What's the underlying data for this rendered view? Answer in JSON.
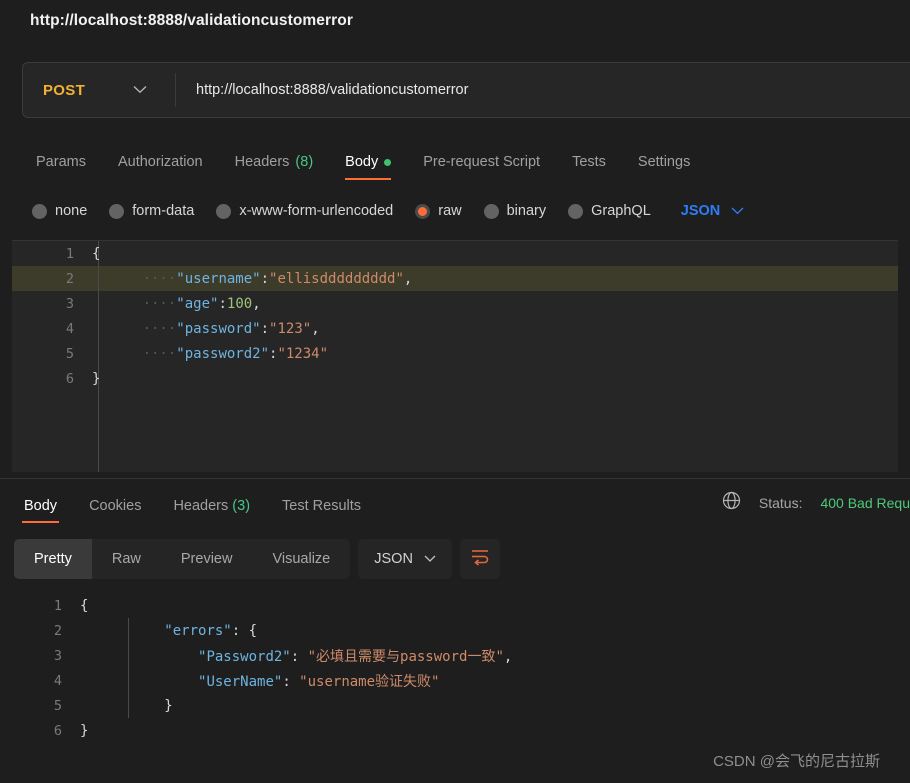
{
  "title": "http://localhost:8888/validationcustomerror",
  "request": {
    "method": "POST",
    "url": "http://localhost:8888/validationcustomerror",
    "tabs": [
      {
        "label": "Params",
        "active": false
      },
      {
        "label": "Authorization",
        "active": false
      },
      {
        "label": "Headers",
        "count": "(8)",
        "active": false
      },
      {
        "label": "Body",
        "active": true,
        "dot": true
      },
      {
        "label": "Pre-request Script",
        "active": false
      },
      {
        "label": "Tests",
        "active": false
      },
      {
        "label": "Settings",
        "active": false
      }
    ],
    "body_types": [
      {
        "label": "none",
        "selected": false
      },
      {
        "label": "form-data",
        "selected": false
      },
      {
        "label": "x-www-form-urlencoded",
        "selected": false
      },
      {
        "label": "raw",
        "selected": true
      },
      {
        "label": "binary",
        "selected": false
      },
      {
        "label": "GraphQL",
        "selected": false
      }
    ],
    "format": "JSON",
    "code": {
      "line_numbers": [
        "1",
        "2",
        "3",
        "4",
        "5",
        "6"
      ],
      "lines": [
        {
          "open": "{"
        },
        {
          "dots": "····",
          "key": "\"username\"",
          "colon": ":",
          "value": "\"ellisddddddddd\"",
          "tail": ","
        },
        {
          "dots": "····",
          "key": "\"age\"",
          "colon": ":",
          "num": "100",
          "tail": ","
        },
        {
          "dots": "····",
          "key": "\"password\"",
          "colon": ":",
          "value": "\"123\"",
          "tail": ","
        },
        {
          "dots": "····",
          "key": "\"password2\"",
          "colon": ":",
          "value": "\"1234\"",
          "tail": ""
        },
        {
          "close": "}"
        }
      ]
    }
  },
  "response": {
    "tabs": [
      {
        "label": "Body",
        "active": true
      },
      {
        "label": "Cookies",
        "active": false
      },
      {
        "label": "Headers",
        "count": "(3)",
        "active": false
      },
      {
        "label": "Test Results",
        "active": false
      }
    ],
    "status_label": "Status:",
    "status_value": "400 Bad Requ",
    "view_modes": [
      {
        "label": "Pretty",
        "active": true
      },
      {
        "label": "Raw",
        "active": false
      },
      {
        "label": "Preview",
        "active": false
      },
      {
        "label": "Visualize",
        "active": false
      }
    ],
    "format": "JSON",
    "code": {
      "line_numbers": [
        "1",
        "2",
        "3",
        "4",
        "5",
        "6"
      ],
      "lines": [
        {
          "indent": "",
          "open": "{"
        },
        {
          "indent": "    ",
          "key": "\"errors\"",
          "colon": ": ",
          "open": "{"
        },
        {
          "indent": "        ",
          "key": "\"Password2\"",
          "colon": ": ",
          "value": "\"必填且需要与password一致\"",
          "tail": ","
        },
        {
          "indent": "        ",
          "key": "\"UserName\"",
          "colon": ": ",
          "value": "\"username验证失败\"",
          "tail": ""
        },
        {
          "indent": "    ",
          "close": "}"
        },
        {
          "indent": "",
          "close": "}"
        }
      ]
    }
  },
  "watermark": "CSDN @会飞的尼古拉斯",
  "colors": {
    "accent": "#ff6c37",
    "method": "#f2b230",
    "json_blue": "#2f7df6",
    "status_green": "#4ec97a"
  }
}
